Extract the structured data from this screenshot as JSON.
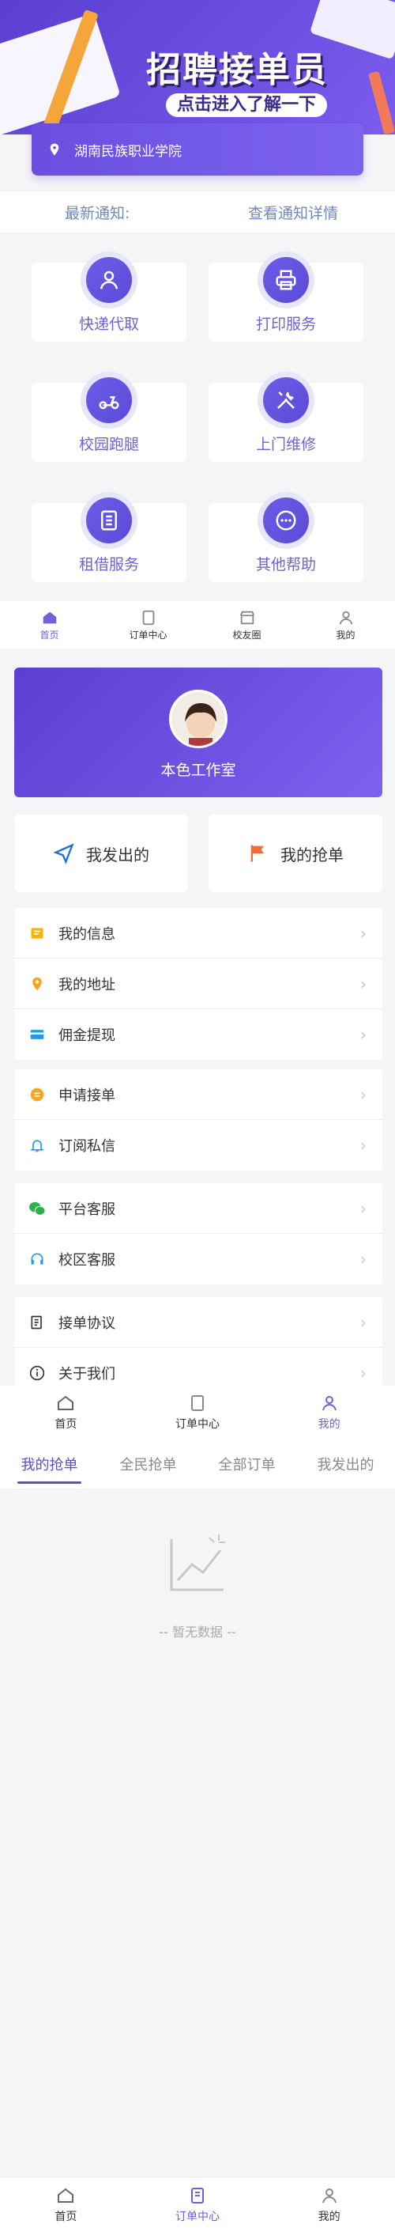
{
  "banner": {
    "title": "招聘接单员",
    "subtitle": "点击进入了解一下"
  },
  "location": {
    "school": "湖南民族职业学院"
  },
  "notice": {
    "left": "最新通知:",
    "right": "查看通知详情"
  },
  "services": [
    {
      "label": "快递代取",
      "icon": "courier-icon"
    },
    {
      "label": "打印服务",
      "icon": "printer-icon"
    },
    {
      "label": "校园跑腿",
      "icon": "scooter-icon"
    },
    {
      "label": "上门维修",
      "icon": "tools-icon"
    },
    {
      "label": "租借服务",
      "icon": "rent-icon"
    },
    {
      "label": "其他帮助",
      "icon": "more-icon"
    }
  ],
  "tabbar_small": [
    {
      "label": "首页",
      "icon": "home-icon",
      "active": true
    },
    {
      "label": "订单中心",
      "icon": "order-icon",
      "active": false
    },
    {
      "label": "校友圈",
      "icon": "shop-icon",
      "active": false
    },
    {
      "label": "我的",
      "icon": "user-icon",
      "active": false
    }
  ],
  "profile": {
    "name": "本色工作室"
  },
  "quick": {
    "sent": "我发出的",
    "grabbed": "我的抢单"
  },
  "menu": {
    "group1": [
      {
        "label": "我的信息",
        "icon": "info-card-icon",
        "color": "#f5b400"
      },
      {
        "label": "我的地址",
        "icon": "location-pin-icon",
        "color": "#f5a623"
      },
      {
        "label": "佣金提现",
        "icon": "wallet-icon",
        "color": "#1e9bf0"
      }
    ],
    "group2": [
      {
        "label": "申请接单",
        "icon": "coin-icon",
        "color": "#f5a623"
      },
      {
        "label": "订阅私信",
        "icon": "bell-icon",
        "color": "#1e9bf0"
      }
    ],
    "group3": [
      {
        "label": "平台客服",
        "icon": "wechat-icon",
        "color": "#2bb24c"
      },
      {
        "label": "校区客服",
        "icon": "headset-icon",
        "color": "#1e9bf0"
      }
    ],
    "group4": [
      {
        "label": "接单协议",
        "icon": "document-icon",
        "color": "#333333"
      },
      {
        "label": "关于我们",
        "icon": "about-icon",
        "color": "#333333"
      }
    ]
  },
  "tabbar_mid": [
    {
      "label": "首页",
      "icon": "home-icon",
      "active": false
    },
    {
      "label": "订单中心",
      "icon": "order-icon",
      "active": false
    },
    {
      "label": "我的",
      "icon": "user-icon",
      "active": true
    }
  ],
  "order_tabs": [
    {
      "label": "我的抢单",
      "active": true
    },
    {
      "label": "全民抢单",
      "active": false
    },
    {
      "label": "全部订单",
      "active": false
    },
    {
      "label": "我发出的",
      "active": false
    }
  ],
  "empty": {
    "text": "-- 暂无数据 --"
  },
  "tabbar_bottom": [
    {
      "label": "首页",
      "icon": "home-icon",
      "active": false
    },
    {
      "label": "订单中心",
      "icon": "order-icon",
      "active": true
    },
    {
      "label": "我的",
      "icon": "user-icon",
      "active": false
    }
  ],
  "colors": {
    "accent": "#6c63d8",
    "banner": "#5a3fd1"
  }
}
